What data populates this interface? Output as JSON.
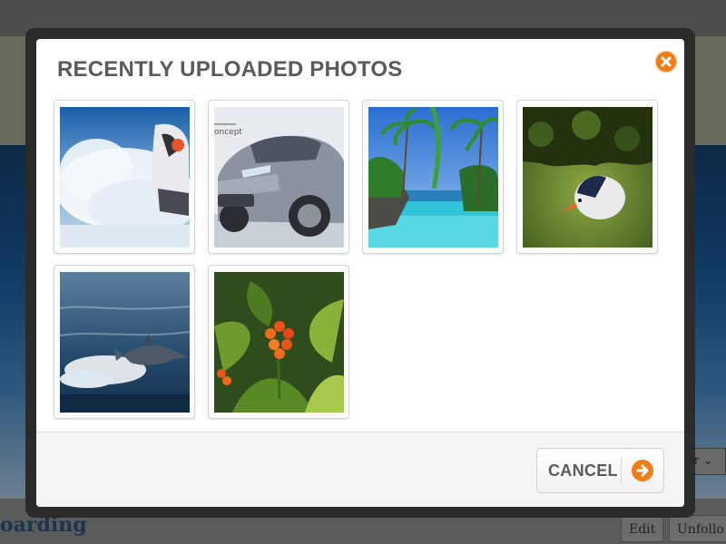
{
  "background": {
    "page_title": "oarding",
    "buttons": {
      "edit": "Edit",
      "unfollow": "Unfollo"
    },
    "select_value": "er"
  },
  "modal": {
    "title": "RECENTLY UPLOADED PHOTOS",
    "close_icon": "close-icon",
    "photos": [
      {
        "name": "photo-jetski",
        "subject": "jetski-spray"
      },
      {
        "name": "photo-car",
        "subject": "silver-suv-concept",
        "caption": "oncept"
      },
      {
        "name": "photo-pool",
        "subject": "tropical-pool-palms"
      },
      {
        "name": "photo-bird",
        "subject": "bird-hanging"
      },
      {
        "name": "photo-dolphin",
        "subject": "dolphin-jumping"
      },
      {
        "name": "photo-flower",
        "subject": "orange-flower-leaves"
      }
    ],
    "footer": {
      "cancel_label": "CANCEL",
      "cancel_icon": "arrow-right-circle-icon"
    }
  },
  "colors": {
    "accent": "#ef7d18",
    "title_text": "#5b5b5b",
    "overlay_frame": "#2b2b2b"
  }
}
